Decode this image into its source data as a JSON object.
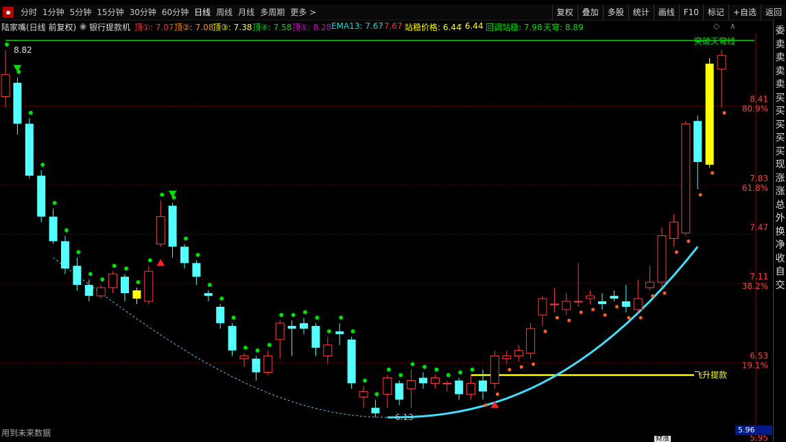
{
  "toolbar": {
    "icon": "▪",
    "periods": [
      "分时",
      "1分钟",
      "5分钟",
      "15分钟",
      "30分钟",
      "60分钟",
      "日线",
      "周线",
      "月线",
      "多周期",
      "更多 >"
    ],
    "active_period": "日线",
    "right_buttons": [
      "复权",
      "叠加",
      "多股",
      "统计",
      "画线",
      "F10",
      "标记",
      "+自选",
      "返回"
    ]
  },
  "infobar": {
    "stock": "陆家嘴(日线 前复权)",
    "indicator": "银行提款机",
    "items": [
      {
        "label": "顶①: 7.07",
        "color": "#ff3030"
      },
      {
        "label": "顶②: 7.08",
        "color": "#ff9000"
      },
      {
        "label": "顶③: 7.38",
        "color": "#ffff00"
      },
      {
        "label": "顶④: 7.58",
        "color": "#00e000"
      },
      {
        "label": "顶⑤: 8.28",
        "color": "#d000d0"
      },
      {
        "label": "EMA13: 7.67",
        "color": "#00e0e0"
      },
      {
        "label": ": 7.67",
        "color": "#ff3030"
      },
      {
        "label": "站稳价格: 6.44",
        "color": "#ffff00"
      },
      {
        "label": ": 6.44",
        "color": "#ffff00"
      },
      {
        "label": "回调站稳: 7.98",
        "color": "#00e000"
      },
      {
        "label": "天穹: 8.89",
        "color": "#00e000"
      }
    ]
  },
  "chart_data": {
    "type": "candlestick",
    "y_range": [
      5.95,
      8.95
    ],
    "y_ticks": [
      {
        "price": "8.41",
        "pct": "80.9%"
      },
      {
        "price": "7.83",
        "pct": "61.8%"
      },
      {
        "price": "7.47",
        "pct": ""
      },
      {
        "price": "7.11",
        "pct": "38.2%"
      },
      {
        "price": "6.53",
        "pct": "19.1%"
      }
    ],
    "label_sky_line": "突破天穹线",
    "label_fly_line": "飞升提款",
    "high_label": "8.82",
    "low_label": "6.13",
    "bottom_value": "5.95",
    "candles": [
      [
        8.48,
        8.64,
        8.82,
        8.4
      ],
      [
        8.58,
        8.28,
        8.62,
        8.2
      ],
      [
        8.28,
        7.9,
        8.32,
        7.88
      ],
      [
        7.9,
        7.6,
        7.94,
        7.56
      ],
      [
        7.6,
        7.42,
        7.66,
        7.4
      ],
      [
        7.42,
        7.22,
        7.46,
        7.18
      ],
      [
        7.24,
        7.1,
        7.3,
        7.06
      ],
      [
        7.1,
        7.02,
        7.14,
        6.98
      ],
      [
        7.02,
        7.08,
        7.1,
        7.0
      ],
      [
        7.08,
        7.18,
        7.2,
        7.04
      ],
      [
        7.16,
        7.04,
        7.18,
        6.98
      ],
      [
        7.06,
        7.0,
        7.08,
        6.96
      ],
      [
        6.98,
        7.2,
        7.24,
        6.96
      ],
      [
        7.4,
        7.6,
        7.72,
        7.38
      ],
      [
        7.68,
        7.38,
        7.7,
        7.3
      ],
      [
        7.38,
        7.26,
        7.4,
        7.22
      ],
      [
        7.26,
        7.16,
        7.28,
        7.1
      ],
      [
        7.04,
        7.02,
        7.06,
        6.98
      ],
      [
        6.94,
        6.82,
        6.96,
        6.78
      ],
      [
        6.8,
        6.62,
        6.82,
        6.58
      ],
      [
        6.56,
        6.58,
        6.6,
        6.5
      ],
      [
        6.56,
        6.46,
        6.58,
        6.4
      ],
      [
        6.46,
        6.58,
        6.62,
        6.44
      ],
      [
        6.7,
        6.82,
        6.84,
        6.56
      ],
      [
        6.8,
        6.78,
        6.84,
        6.58
      ],
      [
        6.82,
        6.78,
        6.86,
        6.74
      ],
      [
        6.8,
        6.64,
        6.82,
        6.58
      ],
      [
        6.58,
        6.66,
        6.72,
        6.52
      ],
      [
        6.76,
        6.74,
        6.82,
        6.66
      ],
      [
        6.7,
        6.38,
        6.72,
        6.34
      ],
      [
        6.28,
        6.32,
        6.36,
        6.2
      ],
      [
        6.2,
        6.16,
        6.26,
        6.13
      ],
      [
        6.3,
        6.42,
        6.44,
        6.2
      ],
      [
        6.38,
        6.26,
        6.4,
        6.22
      ],
      [
        6.34,
        6.4,
        6.48,
        6.2
      ],
      [
        6.42,
        6.38,
        6.46,
        6.34
      ],
      [
        6.38,
        6.42,
        6.44,
        6.34
      ],
      [
        6.38,
        6.38,
        6.4,
        6.32
      ],
      [
        6.4,
        6.3,
        6.42,
        6.26
      ],
      [
        6.3,
        6.38,
        6.44,
        6.26
      ],
      [
        6.4,
        6.32,
        6.48,
        6.26
      ],
      [
        6.38,
        6.58,
        6.62,
        6.34
      ],
      [
        6.56,
        6.58,
        6.62,
        6.52
      ],
      [
        6.58,
        6.62,
        6.66,
        6.54
      ],
      [
        6.6,
        6.78,
        6.82,
        6.56
      ],
      [
        6.88,
        7.0,
        7.02,
        6.8
      ],
      [
        6.96,
        6.96,
        7.08,
        6.9
      ],
      [
        6.92,
        6.98,
        7.04,
        6.88
      ],
      [
        6.98,
        6.98,
        7.26,
        6.94
      ],
      [
        7.0,
        7.02,
        7.06,
        6.96
      ],
      [
        6.98,
        6.96,
        7.04,
        6.92
      ],
      [
        7.02,
        7.0,
        7.06,
        6.98
      ],
      [
        6.98,
        6.94,
        7.1,
        6.9
      ],
      [
        6.92,
        7.0,
        7.14,
        6.9
      ],
      [
        7.08,
        7.12,
        7.24,
        7.06
      ],
      [
        7.12,
        7.46,
        7.52,
        7.08
      ],
      [
        7.44,
        7.56,
        7.62,
        7.38
      ],
      [
        7.48,
        8.28,
        8.3,
        7.46
      ],
      [
        8.3,
        8.0,
        8.34,
        7.8
      ],
      [
        7.98,
        8.72,
        8.76,
        7.96
      ],
      [
        8.68,
        8.78,
        8.82,
        8.4
      ]
    ],
    "yellow_indices": [
      11,
      59
    ],
    "up_arrows": [
      13,
      41
    ],
    "down_arrows": [
      1,
      14
    ],
    "series": [
      {
        "name": "EMA13",
        "color": "#00e000"
      },
      {
        "name": "天穹",
        "color": "#00e000"
      }
    ]
  },
  "right_panel": [
    "委",
    "卖",
    "卖",
    "卖",
    "卖",
    "买",
    "买",
    "买",
    "买",
    "买",
    "现",
    "涨",
    "涨",
    "总",
    "外",
    "换",
    "净",
    "收",
    "自",
    "交"
  ],
  "bottom_note": "用到未来数据",
  "bottom_badge": "财涨",
  "price_box": "5.96",
  "colors": {
    "up": "#ff3c3c",
    "down": "#54ffff",
    "yellow": "#ffff00",
    "green": "#00e000"
  }
}
